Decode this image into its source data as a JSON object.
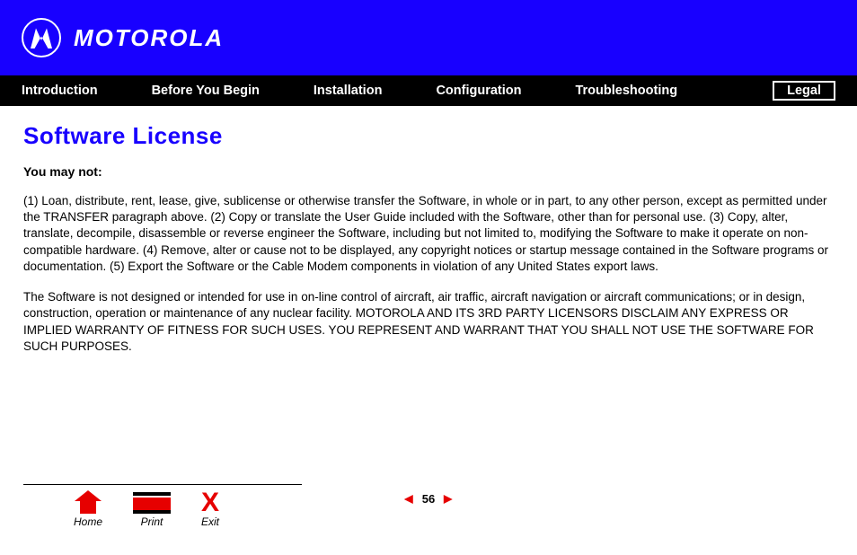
{
  "header": {
    "brand": "MOTOROLA"
  },
  "nav": {
    "items": [
      "Introduction",
      "Before You Begin",
      "Installation",
      "Configuration",
      "Troubleshooting"
    ],
    "active": "Legal"
  },
  "page": {
    "title": "Software License",
    "subhead": "You may not:",
    "para1": "(1) Loan, distribute, rent, lease, give, sublicense or otherwise transfer the Software, in whole or in part, to any other person, except as permitted under the TRANSFER paragraph above. (2) Copy or translate the User Guide included with the Software, other than for personal use. (3) Copy, alter, translate, decompile, disassemble or reverse engineer the Software, including but not limited to, modifying the Software to make it operate on non-compatible hardware. (4) Remove, alter or cause not to be displayed, any copyright notices or startup message contained in the Software programs or documentation. (5) Export the Software or the Cable Modem components in violation of any United States export laws.",
    "para2": "The Software is not designed or intended for use in on-line control of aircraft, air traffic, aircraft navigation or aircraft communications; or in design, construction, operation or maintenance of any nuclear facility. MOTOROLA AND ITS 3RD PARTY LICENSORS DISCLAIM ANY EXPRESS OR IMPLIED WARRANTY OF FITNESS FOR SUCH USES. YOU REPRESENT AND WARRANT THAT YOU SHALL NOT USE THE SOFTWARE FOR SUCH PURPOSES."
  },
  "footer": {
    "home": "Home",
    "print": "Print",
    "exit": "Exit",
    "page": "56"
  }
}
